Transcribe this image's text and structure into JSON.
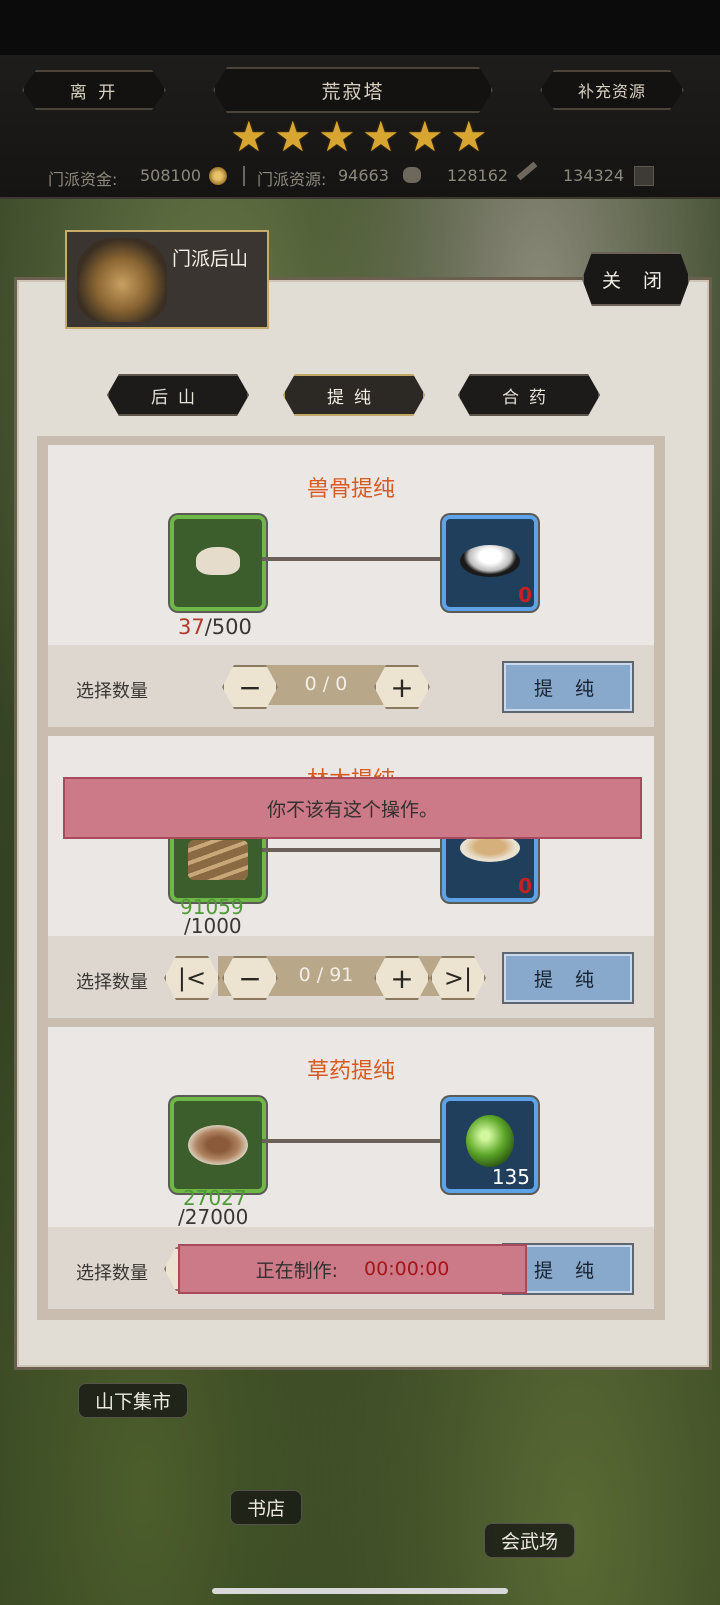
{
  "top": {
    "leave_label": "离 开",
    "title": "荒寂塔",
    "replenish_label": "补充资源",
    "stars": 6,
    "funds_label": "门派资金:",
    "funds_value": "508100",
    "resources_label": "门派资源:",
    "res1": "94663",
    "res2": "128162",
    "res3": "134324"
  },
  "panel": {
    "header_title": "门派后山",
    "close_label": "关 闭",
    "tabs": [
      "后山",
      "提纯",
      "合药"
    ],
    "active_tab": "提纯"
  },
  "cards": [
    {
      "title": "兽骨提纯",
      "have": "37",
      "need": "/500",
      "output_count": "0",
      "qty_label": "选择数量",
      "qty_value": "0 / 0",
      "action_label": "提 纯"
    },
    {
      "title": "林木提纯",
      "have": "91059",
      "need": "/1000",
      "output_count": "0",
      "qty_label": "选择数量",
      "qty_value": "0 / 91",
      "action_label": "提 纯"
    },
    {
      "title": "草药提纯",
      "have": "27027",
      "need": "/27000",
      "output_count": "135",
      "qty_label": "选择数量",
      "action_label": "提 纯"
    }
  ],
  "toast": "你不该有这个操作。",
  "busy": {
    "label": "正在制作:",
    "time": "00:00:00"
  },
  "map_labels": [
    "山下集市",
    "书店",
    "会武场"
  ],
  "colors": {
    "accent_orange": "#d85a1e",
    "red_count": "#c32222",
    "green_count": "#4e9a36"
  }
}
